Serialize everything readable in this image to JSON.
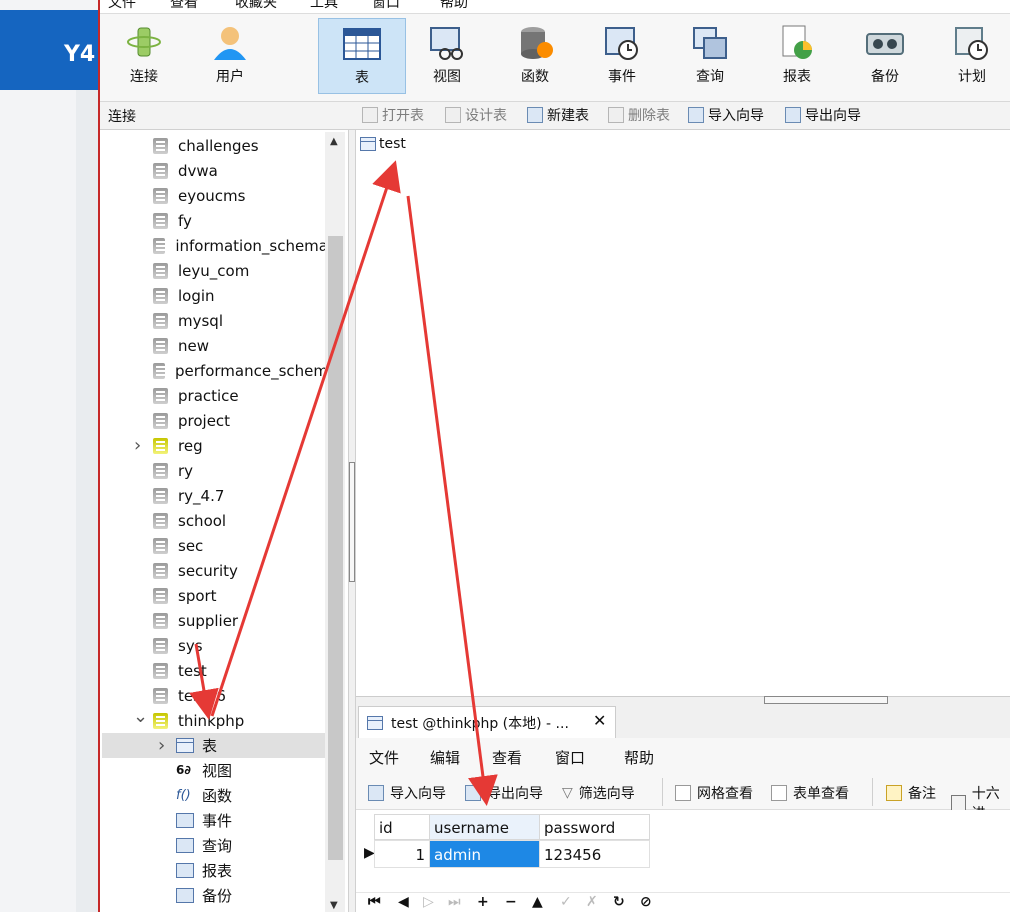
{
  "background_app": {
    "label": "Y4"
  },
  "menubar": {
    "items": [
      "文件",
      "查看",
      "收藏夹",
      "工具",
      "窗口",
      "帮助"
    ]
  },
  "toolbar": {
    "buttons": [
      {
        "label": "连接",
        "icon": "connection-icon"
      },
      {
        "label": "用户",
        "icon": "user-icon"
      },
      {
        "label": "表",
        "icon": "table-icon",
        "active": true
      },
      {
        "label": "视图",
        "icon": "view-icon"
      },
      {
        "label": "函数",
        "icon": "function-icon"
      },
      {
        "label": "事件",
        "icon": "event-icon"
      },
      {
        "label": "查询",
        "icon": "query-icon"
      },
      {
        "label": "报表",
        "icon": "report-icon"
      },
      {
        "label": "备份",
        "icon": "backup-icon"
      },
      {
        "label": "计划",
        "icon": "schedule-icon"
      }
    ]
  },
  "connection_bar": {
    "label": "连接"
  },
  "object_toolbar": {
    "open_table": "打开表",
    "design_table": "设计表",
    "new_table": "新建表",
    "delete_table": "删除表",
    "import_wizard": "导入向导",
    "export_wizard": "导出向导"
  },
  "tree": {
    "databases": [
      "challenges",
      "dvwa",
      "eyoucms",
      "fy",
      "information_schema",
      "leyu_com",
      "login",
      "mysql",
      "new",
      "performance_schem",
      "practice",
      "project",
      "reg",
      "ry",
      "ry_4.7",
      "school",
      "sec",
      "security",
      "sport",
      "supplier",
      "sys",
      "test",
      "test66",
      "thinkphp"
    ],
    "children": [
      "表",
      "视图",
      "函数",
      "事件",
      "查询",
      "报表",
      "备份"
    ],
    "func_glyph": "f()",
    "view_glyph": "6∂"
  },
  "objects": {
    "items": [
      "test"
    ]
  },
  "tab": {
    "title": "test @thinkphp (本地) - ...",
    "close": "✕"
  },
  "sub_menu": {
    "items": [
      "文件",
      "编辑",
      "查看",
      "窗口",
      "帮助"
    ]
  },
  "sub_toolbar": {
    "import_wizard": "导入向导",
    "export_wizard": "导出向导",
    "filter_wizard": "筛选向导",
    "grid_view": "网格查看",
    "form_view": "表单查看",
    "memo": "备注",
    "hex": "十六进"
  },
  "grid": {
    "columns": [
      "id",
      "username",
      "password"
    ],
    "rows": [
      {
        "id": "1",
        "username": "admin",
        "password": "123456"
      }
    ]
  },
  "nav": {
    "first": "⏮",
    "prev": "◀",
    "next": "▷",
    "last": "⏭",
    "add": "+",
    "delete": "−",
    "up": "▲",
    "apply": "✓",
    "cancel": "✗",
    "refresh": "↻",
    "stop": "⊘"
  },
  "colors": {
    "arrow": "#e53935",
    "selection": "#1e88e5",
    "active_toolbar": "#cde4f7"
  }
}
